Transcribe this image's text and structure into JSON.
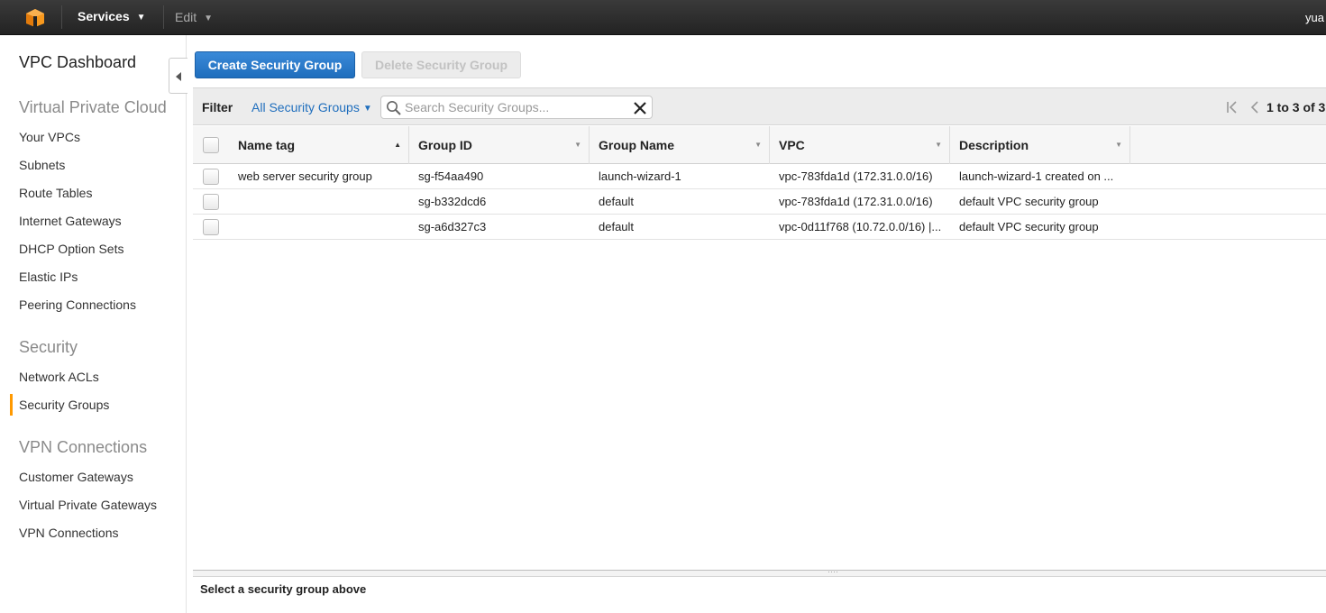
{
  "topbar": {
    "services_label": "Services",
    "edit_label": "Edit",
    "user_label": "yua"
  },
  "sidebar": {
    "title": "VPC Dashboard",
    "sections": [
      {
        "label": "Virtual Private Cloud",
        "items": [
          "Your VPCs",
          "Subnets",
          "Route Tables",
          "Internet Gateways",
          "DHCP Option Sets",
          "Elastic IPs",
          "Peering Connections"
        ]
      },
      {
        "label": "Security",
        "items": [
          "Network ACLs",
          "Security Groups"
        ]
      },
      {
        "label": "VPN Connections",
        "items": [
          "Customer Gateways",
          "Virtual Private Gateways",
          "VPN Connections"
        ]
      }
    ],
    "active_item": "Security Groups"
  },
  "toolbar": {
    "create_label": "Create Security Group",
    "delete_label": "Delete Security Group"
  },
  "filter": {
    "label": "Filter",
    "select_value": "All Security Groups",
    "search_placeholder": "Search Security Groups...",
    "pager_text": "1 to 3 of 3"
  },
  "table": {
    "columns": [
      "Name tag",
      "Group ID",
      "Group Name",
      "VPC",
      "Description"
    ],
    "rows": [
      {
        "name_tag": "web server security group",
        "group_id": "sg-f54aa490",
        "group_name": "launch-wizard-1",
        "vpc": "vpc-783fda1d (172.31.0.0/16)",
        "description": "launch-wizard-1 created on ..."
      },
      {
        "name_tag": "",
        "group_id": "sg-b332dcd6",
        "group_name": "default",
        "vpc": "vpc-783fda1d (172.31.0.0/16)",
        "description": "default VPC security group"
      },
      {
        "name_tag": "",
        "group_id": "sg-a6d327c3",
        "group_name": "default",
        "vpc": "vpc-0d11f768 (10.72.0.0/16) |...",
        "description": "default VPC security group"
      }
    ]
  },
  "detail": {
    "placeholder": "Select a security group above"
  },
  "colors": {
    "accent": "#1f6ebd",
    "active_marker": "#ff9900",
    "topbar": "#232323"
  }
}
